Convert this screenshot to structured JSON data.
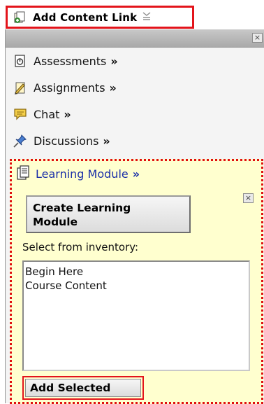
{
  "header": {
    "title": "Add Content Link",
    "icon": "add-link-icon",
    "arrow_icon": "collapse-arrow-icon"
  },
  "panel": {
    "close_symbol": "×",
    "items": [
      {
        "label": "Assessments",
        "icon": "assessment-icon",
        "chevron": "»"
      },
      {
        "label": "Assignments",
        "icon": "assignment-icon",
        "chevron": "»"
      },
      {
        "label": "Chat",
        "icon": "chat-icon",
        "chevron": "»"
      },
      {
        "label": "Discussions",
        "icon": "pushpin-icon",
        "chevron": "»"
      }
    ]
  },
  "learning_module": {
    "title": "Learning Module",
    "chevron": "»",
    "close_symbol": "×",
    "create_button_label": "Create Learning\nModule",
    "inventory_label": "Select from inventory:",
    "inventory_items": [
      "Begin Here",
      "Course Content"
    ],
    "add_button_label": "Add Selected"
  },
  "colors": {
    "highlight_red": "#e3141b",
    "module_background": "#ffffcf",
    "link_blue": "#1a2fa8"
  }
}
